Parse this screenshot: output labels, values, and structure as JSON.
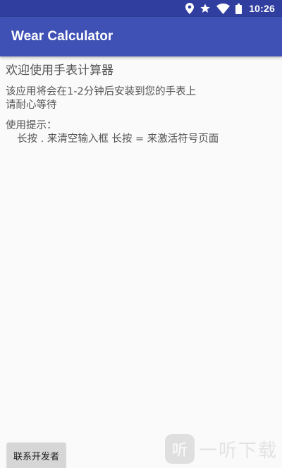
{
  "status_bar": {
    "time": "10:26",
    "icons": [
      "location-icon",
      "star-icon",
      "wifi-icon",
      "battery-icon"
    ],
    "color": "#303f9f"
  },
  "app_bar": {
    "title": "Wear Calculator",
    "color": "#3f51b5"
  },
  "content": {
    "welcome": "欢迎使用手表计算器",
    "install_line1": "该应用将会在1-2分钟后安装到您的手表上",
    "install_line2": "请耐心等待",
    "tips_title": "使用提示：",
    "tips_body": "长按 . 来清空输入框 长按 = 来激活符号页面"
  },
  "footer": {
    "contact_button_label": "联系开发者"
  },
  "watermark": {
    "logo_glyph": "听",
    "text": "一听下载"
  }
}
